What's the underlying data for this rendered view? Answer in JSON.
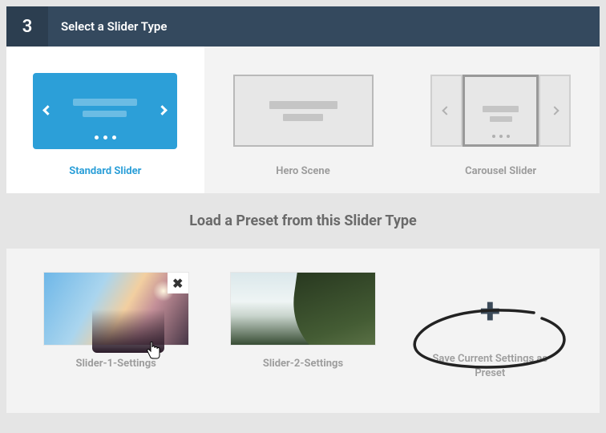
{
  "step": "3",
  "header_title": "Select a Slider Type",
  "types": {
    "standard": "Standard Slider",
    "hero": "Hero Scene",
    "carousel": "Carousel Slider"
  },
  "preset_heading": "Load a Preset from this Slider Type",
  "presets": [
    {
      "label": "Slider-1-Settings"
    },
    {
      "label": "Slider-2-Settings"
    }
  ],
  "save_preset_label": "Save Current Settings as Preset"
}
